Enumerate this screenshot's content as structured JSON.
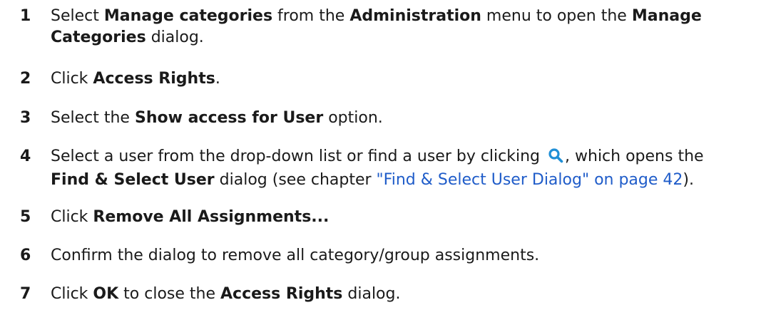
{
  "steps": [
    {
      "number": "1",
      "t1": "Select ",
      "b1": "Manage categories",
      "t2": " from the ",
      "b2": "Administration",
      "t3": " menu to open the ",
      "b3": "Manage",
      "b4": "Categories",
      "t4": " dialog."
    },
    {
      "number": "2",
      "t1": "Click ",
      "b1": "Access Rights",
      "t2": "."
    },
    {
      "number": "3",
      "t1": "Select the ",
      "b1": "Show access for User",
      "t2": " option."
    },
    {
      "number": "4",
      "t1": "Select a user from the drop-down list or find a user by clicking ",
      "t2": ", which opens the",
      "b1": "Find & Select User",
      "t3": " dialog (see chapter ",
      "link": "\"Find & Select User Dialog\" on page 42",
      "t4": ")."
    },
    {
      "number": "5",
      "t1": "Click ",
      "b1": "Remove All Assignments..."
    },
    {
      "number": "6",
      "t1": "Confirm the dialog to remove all category/group assignments."
    },
    {
      "number": "7",
      "t1": "Click ",
      "b1": "OK",
      "t2": " to close the ",
      "b2": "Access Rights",
      "t3": " dialog."
    }
  ],
  "icons": {
    "search": "search-icon",
    "search_color": "#1f8fd6"
  },
  "colors": {
    "text": "#1a1a1a",
    "link": "#1f5cc9"
  }
}
